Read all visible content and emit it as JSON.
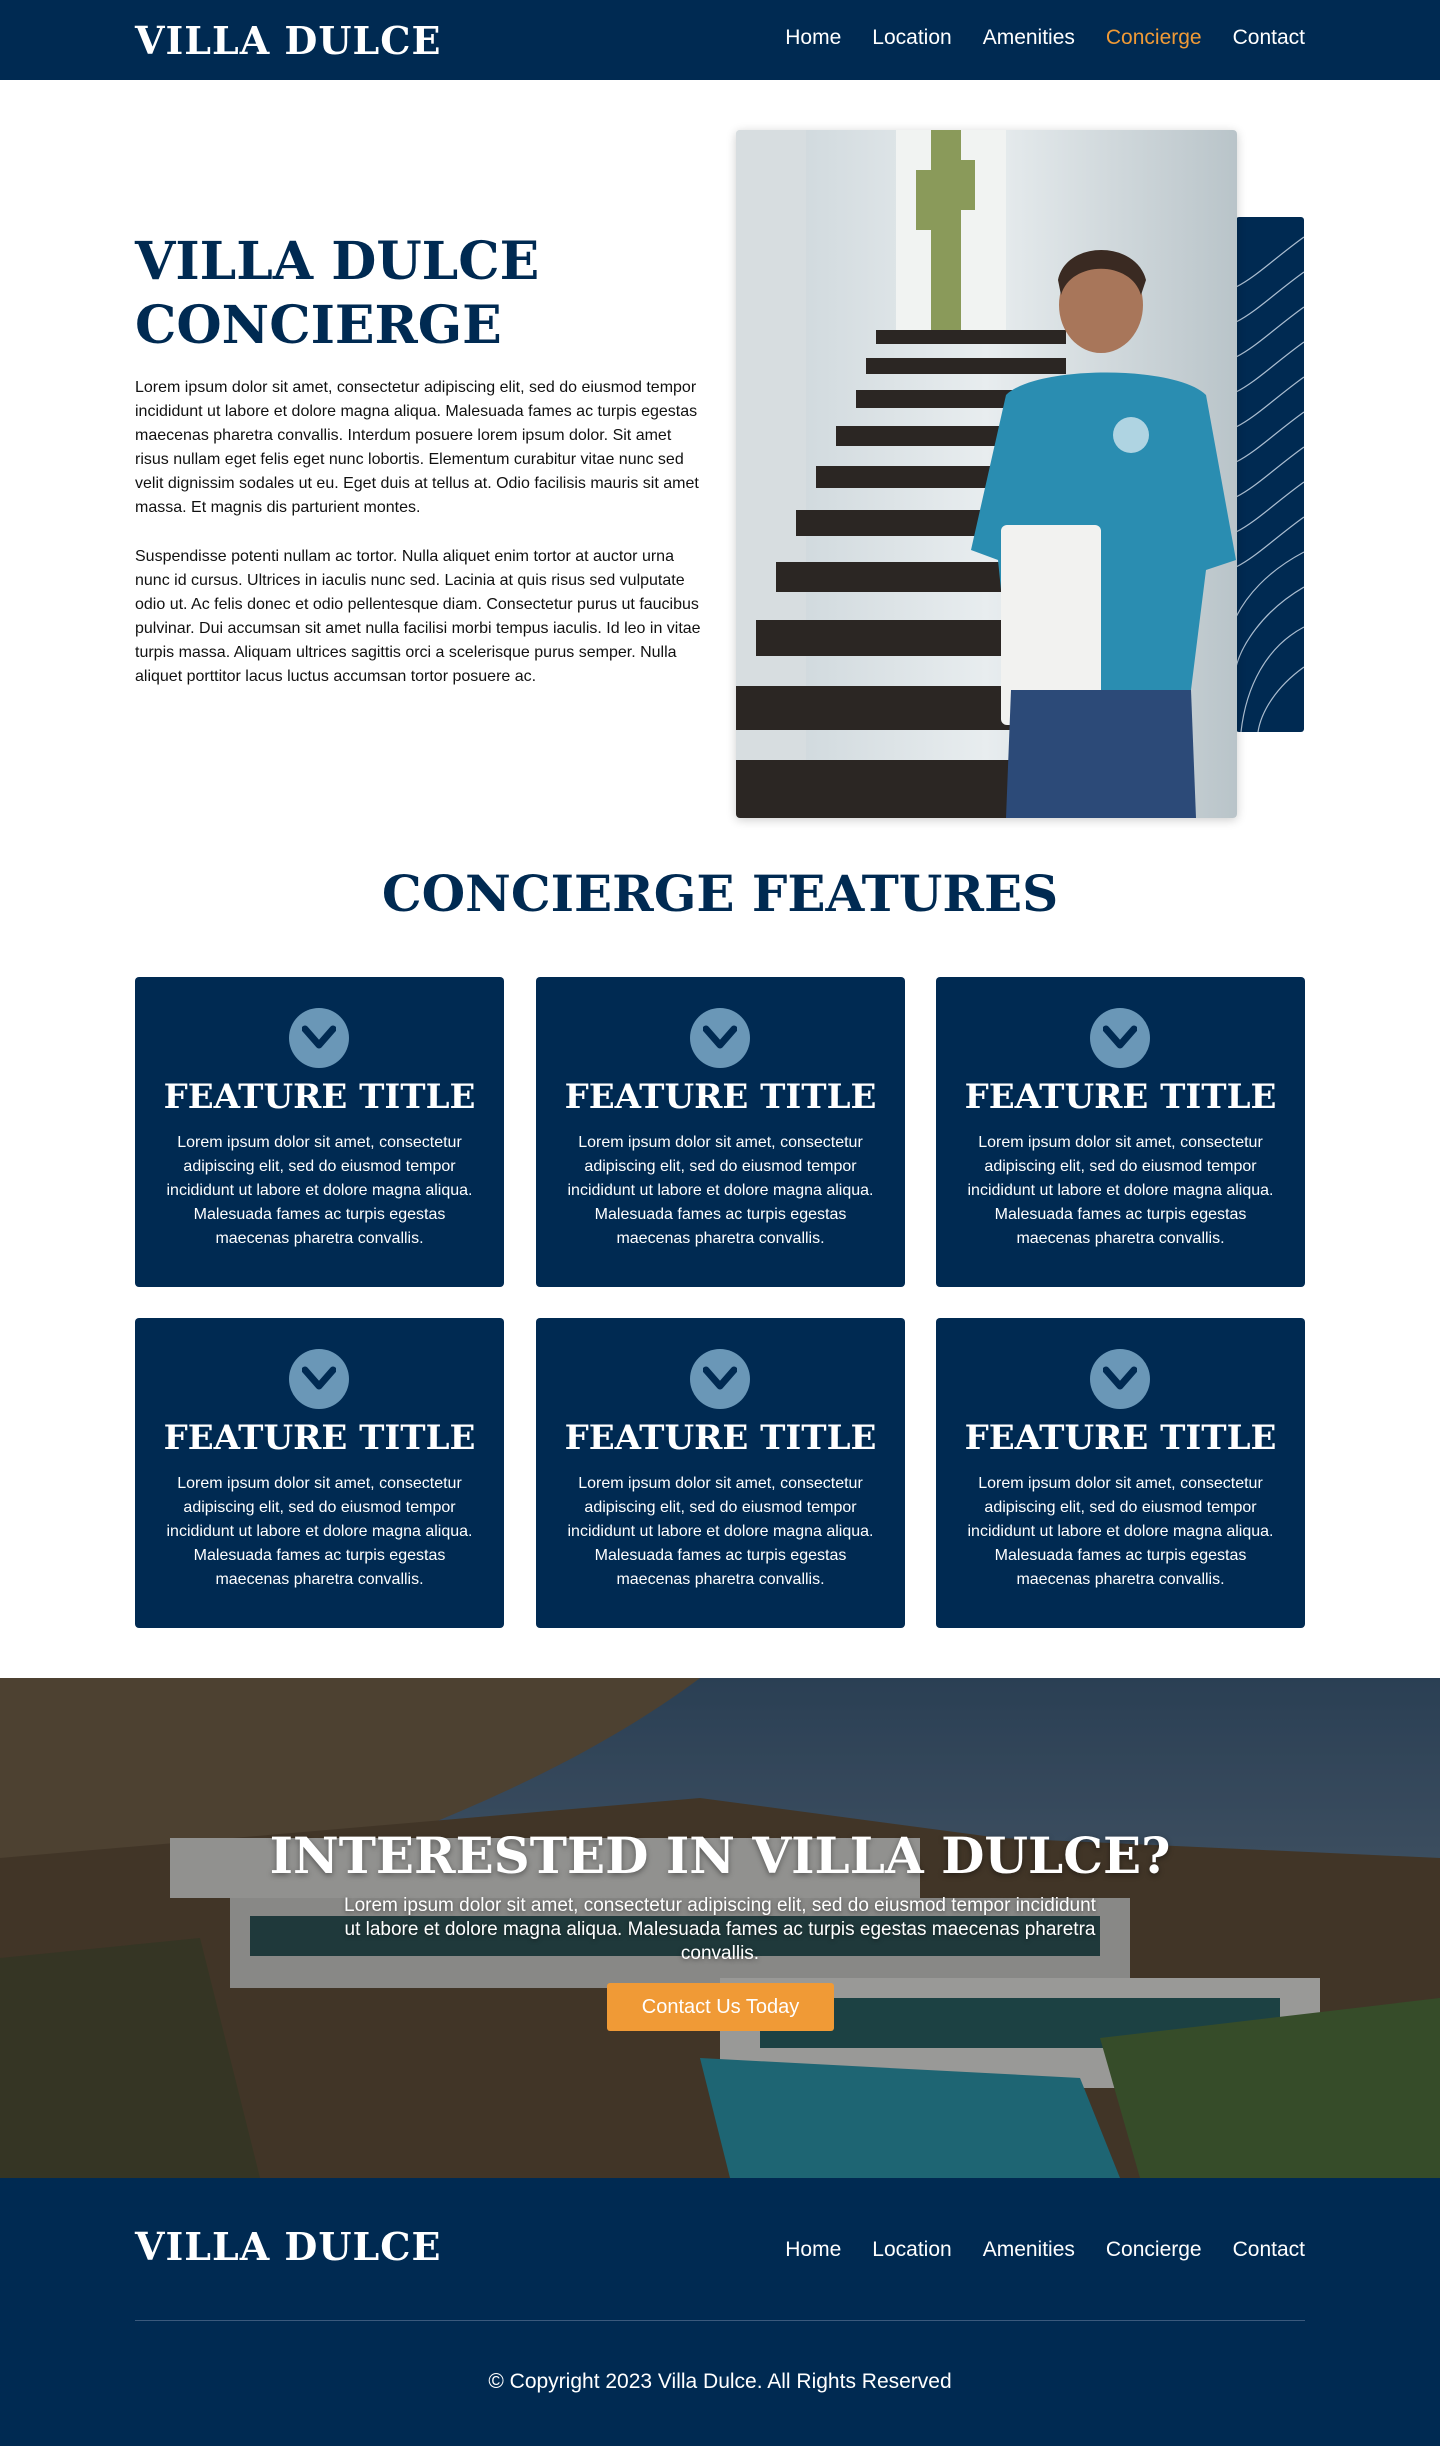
{
  "header": {
    "logo": "VILLA DULCE",
    "nav": [
      "Home",
      "Location",
      "Amenities",
      "Concierge",
      "Contact"
    ],
    "active_item": "Concierge"
  },
  "intro": {
    "title": "VILLA DULCE CONCIERGE",
    "paragraph_1": "Lorem ipsum dolor sit amet, consectetur adipiscing elit, sed do eiusmod tempor incididunt ut labore et dolore magna aliqua. Malesuada fames ac turpis egestas maecenas pharetra convallis. Interdum posuere lorem ipsum dolor. Sit amet risus nullam eget felis eget nunc lobortis. Elementum curabitur vitae nunc sed velit dignissim sodales ut eu. Eget duis at tellus at. Odio facilisis mauris sit amet massa. Et magnis dis parturient montes.",
    "paragraph_2": "Suspendisse potenti nullam ac tortor. Nulla aliquet enim tortor at auctor urna nunc id cursus. Ultrices in iaculis nunc sed. Lacinia at quis risus sed vulputate odio ut. Ac felis donec et odio pellentesque diam. Consectetur purus ut faucibus pulvinar. Dui accumsan sit amet nulla facilisi morbi tempus iaculis. Id leo in vitae turpis massa. Aliquam ultrices sagittis orci a scelerisque purus semper. Nulla aliquet porttitor lacus luctus accumsan tortor posuere ac.",
    "photo_icon": "concierge-staff-photo"
  },
  "features": {
    "title": "CONCIERGE FEATURES",
    "icon": "chevron-down-circle-icon",
    "items": [
      {
        "title": "FEATURE TITLE",
        "text": "Lorem ipsum dolor sit amet, consectetur adipiscing elit, sed do eiusmod tempor incididunt ut labore et dolore magna aliqua. Malesuada fames ac turpis egestas maecenas pharetra convallis."
      },
      {
        "title": "FEATURE TITLE",
        "text": "Lorem ipsum dolor sit amet, consectetur adipiscing elit, sed do eiusmod tempor incididunt ut labore et dolore magna aliqua. Malesuada fames ac turpis egestas maecenas pharetra convallis."
      },
      {
        "title": "FEATURE TITLE",
        "text": "Lorem ipsum dolor sit amet, consectetur adipiscing elit, sed do eiusmod tempor incididunt ut labore et dolore magna aliqua. Malesuada fames ac turpis egestas maecenas pharetra convallis."
      },
      {
        "title": "FEATURE TITLE",
        "text": "Lorem ipsum dolor sit amet, consectetur adipiscing elit, sed do eiusmod tempor incididunt ut labore et dolore magna aliqua. Malesuada fames ac turpis egestas maecenas pharetra convallis."
      },
      {
        "title": "FEATURE TITLE",
        "text": "Lorem ipsum dolor sit amet, consectetur adipiscing elit, sed do eiusmod tempor incididunt ut labore et dolore magna aliqua. Malesuada fames ac turpis egestas maecenas pharetra convallis."
      },
      {
        "title": "FEATURE TITLE",
        "text": "Lorem ipsum dolor sit amet, consectetur adipiscing elit, sed do eiusmod tempor incididunt ut labore et dolore magna aliqua. Malesuada fames ac turpis egestas maecenas pharetra convallis."
      }
    ]
  },
  "cta": {
    "title": "INTERESTED IN VILLA DULCE?",
    "text": "Lorem ipsum dolor sit amet, consectetur adipiscing elit, sed do eiusmod tempor incididunt ut labore et dolore magna aliqua. Malesuada fames ac turpis egestas maecenas pharetra convallis.",
    "button_label": "Contact Us Today"
  },
  "footer": {
    "logo": "VILLA DULCE",
    "nav": [
      "Home",
      "Location",
      "Amenities",
      "Concierge",
      "Contact"
    ],
    "copyright": "© Copyright 2023 Villa Dulce. All Rights Reserved"
  },
  "colors": {
    "navy": "#002a52",
    "accent_orange": "#f09a36",
    "icon_blue": "#6a97b7"
  }
}
